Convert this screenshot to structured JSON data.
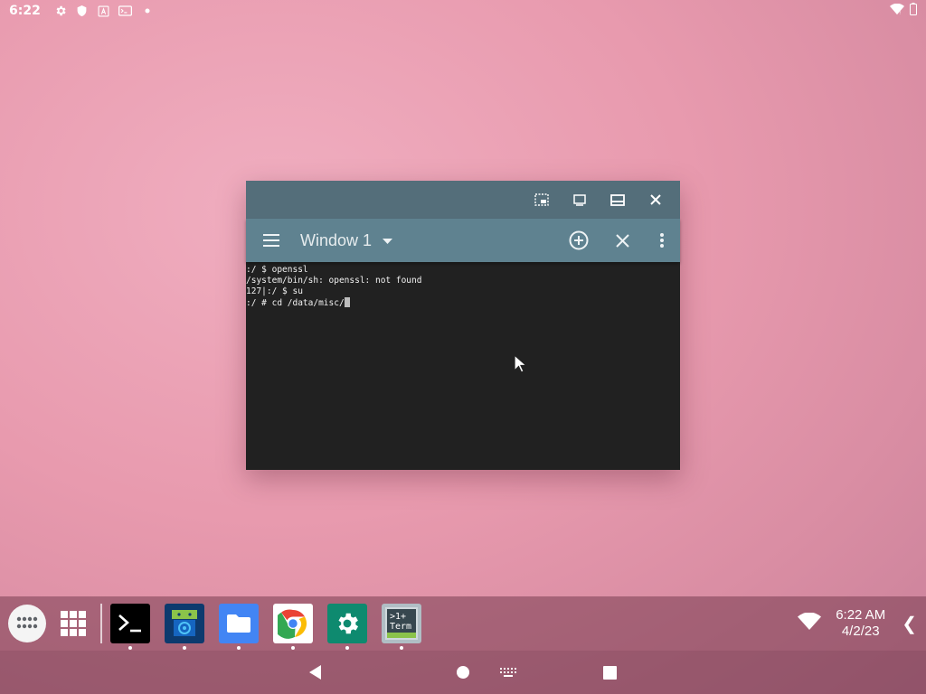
{
  "status_bar": {
    "time": "6:22",
    "icons": [
      "settings-icon",
      "shield-icon",
      "a-icon",
      "terminal-notif-icon",
      "dot-icon"
    ],
    "right_icons": [
      "wifi-icon",
      "battery-icon"
    ]
  },
  "window": {
    "caption_buttons": [
      "pip-icon",
      "restore-icon",
      "maximize-icon",
      "close-icon"
    ],
    "toolbar": {
      "menu_icon": "menu-icon",
      "window_label": "Window 1",
      "add_icon": "add-circle-icon",
      "close_icon": "close-icon",
      "overflow_icon": "more-vert-icon"
    },
    "terminal_lines": [
      ":/ $ openssl",
      "/system/bin/sh: openssl: not found",
      "127|:/ $ su",
      ":/ # cd /data/misc/"
    ]
  },
  "taskbar": {
    "apps": [
      {
        "name": "Termux",
        "icon": "terminal-icon",
        "color": "#000000"
      },
      {
        "name": "App",
        "icon": "android-app-icon",
        "color": "#0d3a6e"
      },
      {
        "name": "Files",
        "icon": "folder-icon",
        "color": "#4285f4"
      },
      {
        "name": "Chrome",
        "icon": "chrome-icon",
        "color": "#ffffff"
      },
      {
        "name": "Settings",
        "icon": "settings-icon",
        "color": "#0e8a6f"
      },
      {
        "name": "Terminal Emulator",
        "icon": "term-icon",
        "color": "#b0bec5"
      }
    ],
    "term_icon_text_1": ">1+",
    "term_icon_text_2": "Term",
    "clock_time": "6:22 AM",
    "clock_date": "4/2/23"
  },
  "colors": {
    "caption": "#546e7a",
    "toolbar": "#5f8290",
    "terminal_bg": "#212121"
  }
}
